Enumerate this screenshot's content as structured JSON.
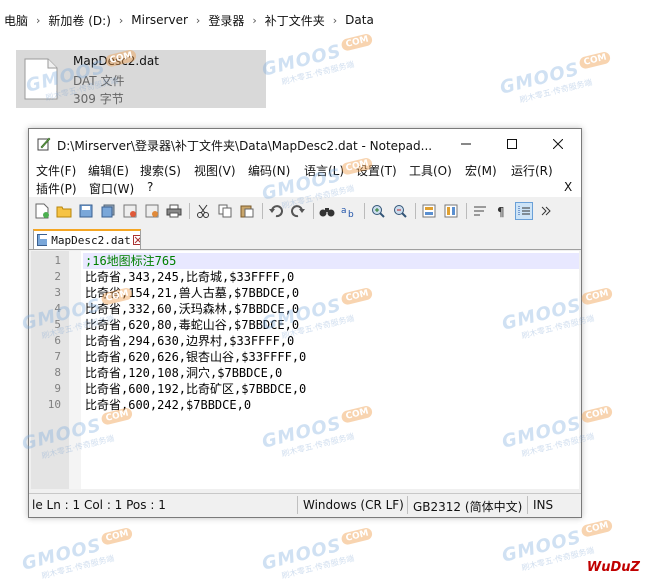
{
  "explorer": {
    "breadcrumb": [
      "电脑",
      "新加卷 (D:)",
      "Mirserver",
      "登录器",
      "补丁文件夹",
      "Data"
    ],
    "file": {
      "name": "MapDesc2.dat",
      "type": "DAT 文件",
      "size": "309 字节"
    }
  },
  "notepad": {
    "title": "D:\\Mirserver\\登录器\\补丁文件夹\\Data\\MapDesc2.dat - Notepad...",
    "menu": [
      "文件(F)",
      "编辑(E)",
      "搜索(S)",
      "视图(V)",
      "编码(N)",
      "语言(L)",
      "设置(T)",
      "工具(O)",
      "宏(M)",
      "运行(R)",
      "插件(P)",
      "窗口(W)",
      "?"
    ],
    "menu_close": "X",
    "tab_label": "MapDesc2.dat",
    "lines": [
      {
        "num": "1",
        "text": ";16地图标注765"
      },
      {
        "num": "2",
        "text": "比奇省,343,245,比奇城,$33FFFF,0"
      },
      {
        "num": "3",
        "text": "比奇省,154,21,兽人古墓,$7BBDCE,0"
      },
      {
        "num": "4",
        "text": "比奇省,332,60,沃玛森林,$7BBDCE,0"
      },
      {
        "num": "5",
        "text": "比奇省,620,80,毒蛇山谷,$7BBDCE,0"
      },
      {
        "num": "6",
        "text": "比奇省,294,630,边界村,$33FFFF,0"
      },
      {
        "num": "7",
        "text": "比奇省,620,626,银杏山谷,$33FFFF,0"
      },
      {
        "num": "8",
        "text": "比奇省,120,108,洞穴,$7BBDCE,0"
      },
      {
        "num": "9",
        "text": "比奇省,600,192,比奇矿区,$7BBDCE,0"
      },
      {
        "num": "10",
        "text": "比奇省,600,242,$7BBDCE,0"
      }
    ],
    "status": {
      "position": "le Ln : 1    Col : 1    Pos : 1",
      "eol": "Windows (CR LF)",
      "encoding": "GB2312 (简体中文)",
      "mode": "INS"
    }
  },
  "watermark": {
    "text": "GMOOS",
    "badge": "COM",
    "sub": "刷木零五·传奇服务端"
  },
  "brand": "WuDuZ"
}
